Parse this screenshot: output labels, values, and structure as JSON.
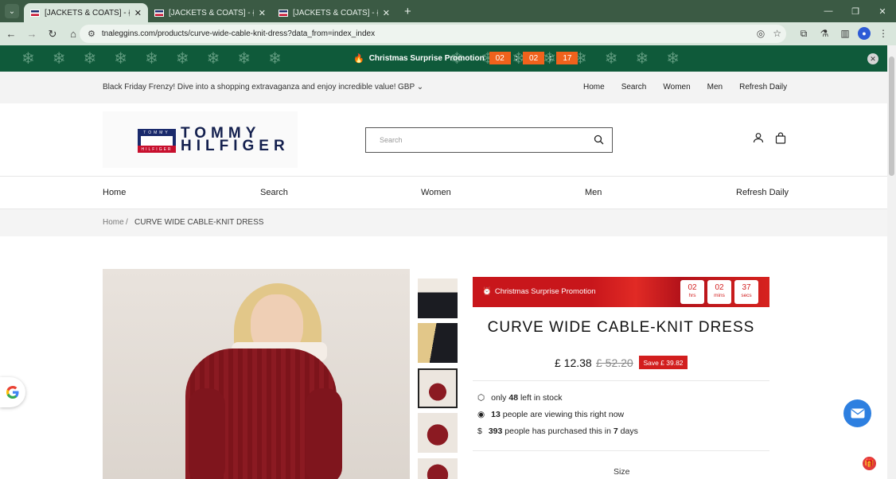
{
  "browser": {
    "tabs": [
      {
        "title": "[JACKETS & COATS] - {tommy h",
        "active": true
      },
      {
        "title": "[JACKETS & COATS] - {tommy h",
        "active": false
      },
      {
        "title": "[JACKETS & COATS] - {tommy h",
        "active": false
      }
    ],
    "url": "tnaleggins.com/products/curve-wide-cable-knit-dress?data_from=index_index"
  },
  "promo_bar": {
    "label": "Christmas Surprise Promotion",
    "hours": "02",
    "minutes": "02",
    "seconds": "17"
  },
  "announcement": {
    "message": "Black Friday Frenzy! Dive into a shopping extravaganza and enjoy incredible value!",
    "currency": "GBP",
    "links": [
      "Home",
      "Search",
      "Women",
      "Men",
      "Refresh Daily"
    ]
  },
  "header": {
    "logo_word1": "TOMMY",
    "logo_word2": "HILFIGER",
    "flag_top": "TOMMY",
    "flag_bottom": "HILFIGER",
    "search_placeholder": "Search"
  },
  "main_nav": [
    "Home",
    "Search",
    "Women",
    "Men",
    "Refresh Daily"
  ],
  "breadcrumb": {
    "home": "Home",
    "separator": "/",
    "current": "CURVE WIDE CABLE-KNIT DRESS"
  },
  "product": {
    "banner_label": "Christmas Surprise Promotion",
    "timer": [
      {
        "value": "02",
        "unit": "hrs"
      },
      {
        "value": "02",
        "unit": "mins"
      },
      {
        "value": "37",
        "unit": "secs"
      }
    ],
    "title": "CURVE WIDE CABLE-KNIT DRESS",
    "price": "£ 12.38",
    "old_price": "£ 52.20",
    "save": "Save £ 39.82",
    "stock": {
      "pre": "only",
      "value": "48",
      "post": "left in stock"
    },
    "viewing": {
      "value": "13",
      "post": "people are viewing this right now"
    },
    "purchased": {
      "value": "393",
      "mid": "people has purchased this in",
      "days": "7",
      "post": "days"
    },
    "size_label": "Size"
  },
  "colors": {
    "promo_bg": "#0f5a3a",
    "accent": "#d21e1e",
    "countdown": "#f0621c"
  }
}
